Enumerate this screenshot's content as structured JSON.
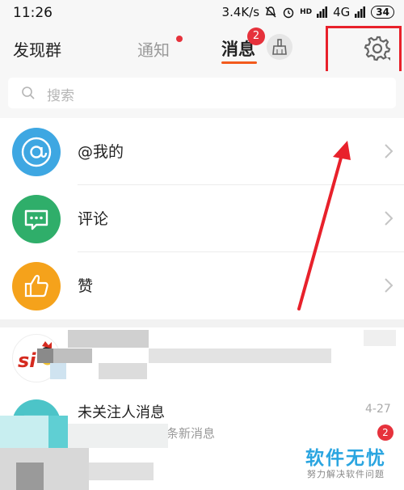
{
  "status_bar": {
    "time": "11:26",
    "speed": "3.4K/s",
    "hd": "HD",
    "network": "4G",
    "battery": "34"
  },
  "top_nav": {
    "discover_label": "发现群",
    "tabs": [
      {
        "label": "通知",
        "active": false,
        "has_dot": true
      },
      {
        "label": "消息",
        "active": true,
        "badge": "2"
      }
    ]
  },
  "search": {
    "placeholder": "搜索"
  },
  "message_rows": [
    {
      "label": "@我的",
      "icon": "at-icon",
      "color": "#3ea7e2"
    },
    {
      "label": "评论",
      "icon": "comment-icon",
      "color": "#2fae6a"
    },
    {
      "label": "赞",
      "icon": "thumbs-up-icon",
      "color": "#f5a21b"
    }
  ],
  "conversations": [
    {
      "name": "未关注人消息",
      "date": "4-27",
      "preview": "条新消息",
      "unread": "2"
    }
  ],
  "watermark": {
    "title": "软件无忧",
    "subtitle": "努力解决软件问题"
  },
  "colors": {
    "accent": "#f25a1c",
    "badge": "#e6323c",
    "annotation": "#e8212b"
  }
}
